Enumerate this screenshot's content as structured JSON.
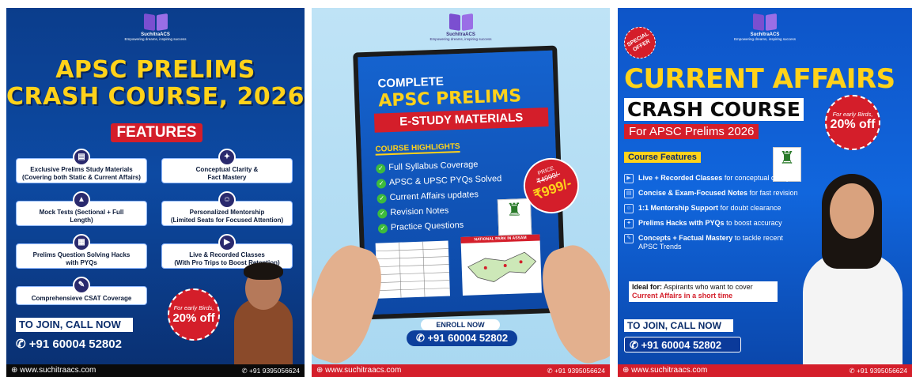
{
  "posters": {
    "p1": {
      "brand": "SuchitraACS",
      "tagline": "Empowering dreams, inspiring success",
      "title_line1": "APSC PRELIMS",
      "title_line2": "CRASH COURSE, 2026",
      "features_label": "FEATURES",
      "features": [
        {
          "icon": "book-icon",
          "l1": "Exclusive Prelims Study Materials",
          "l2": "(Covering both Static & Current Affairs)"
        },
        {
          "icon": "bulb-icon",
          "l1": "Conceptual Clarity &",
          "l2": "Fact Mastery"
        },
        {
          "icon": "graduation-cap-icon",
          "l1": "Mock Tests (Sectional + Full",
          "l2": "Length)"
        },
        {
          "icon": "mentor-icon",
          "l1": "Personalized Mentorship",
          "l2": "(Limited Seats for Focused Attention)"
        },
        {
          "icon": "notebook-icon",
          "l1": "Prelims Question Solving Hacks",
          "l2": "with PYQs"
        },
        {
          "icon": "video-class-icon",
          "l1": "Live & Recorded Classes",
          "l2": "(With Pro Trips to Boost Retention)"
        },
        {
          "icon": "csat-icon",
          "l1": "Comprehensieve CSAT Coverage",
          "l2": ""
        }
      ],
      "badge_line1": "For early Birds,",
      "badge_line2": "20% off",
      "join": "TO JOIN, CALL NOW",
      "phone": "+91 60004 52802",
      "website": "www.suchitraacs.com",
      "footer_phone": "+91 9395056624"
    },
    "p2": {
      "brand": "SuchitraACS",
      "tagline": "Empowering dreams, inspiring success",
      "complete": "COMPLETE",
      "apsc": "APSC PRELIMS",
      "estudy": "E-STUDY MATERIALS",
      "highlights_label": "COURSE HIGHLIGHTS",
      "highlights": [
        "Full Syllabus Coverage",
        "APSC & UPSC PYQs Solved",
        "Current Affairs updates",
        "Revision Notes",
        "Practice Questions"
      ],
      "price_label": "PRICE",
      "price_old": "₹4999/-",
      "price_new": "₹999/-",
      "map_title": "NATIONAL PARK IN ASSAM",
      "enroll": "ENROLL NOW",
      "phone": "+91 60004 52802",
      "website": "www.suchitraacs.com",
      "footer_phone": "+91 9395056624"
    },
    "p3": {
      "brand": "SuchitraACS",
      "tagline": "Empowering dreams, inspiring success",
      "special": "SPECIAL OFFER",
      "title": "CURRENT AFFAIRS",
      "crash": "CRASH COURSE",
      "for": "For APSC Prelims 2026",
      "badge_line1": "For early Birds,",
      "badge_line2": "20% off",
      "cf_label": "Course Features",
      "features": [
        {
          "icon": "video-icon",
          "b": "Live + Recorded Classes",
          "r": " for conceptual clarity"
        },
        {
          "icon": "notes-icon",
          "b": "Concise & Exam-Focused Notes",
          "r": " for fast revision"
        },
        {
          "icon": "mentor-icon",
          "b": "1:1 Mentorship Support",
          "r": " for doubt clearance"
        },
        {
          "icon": "hacks-icon",
          "b": "Prelims Hacks with PYQs",
          "r": " to boost accuracy"
        },
        {
          "icon": "concepts-icon",
          "b": "Concepts + Factual Mastery",
          "r": " to tackle recent APSC Trends"
        }
      ],
      "ideal_b": "Ideal for:",
      "ideal_r": " Aspirants who want to cover",
      "ideal_red": "Current Affairs in a short time",
      "join": "TO JOIN, CALL NOW",
      "phone": "+91 60004 52802",
      "website": "www.suchitraacs.com",
      "footer_phone": "+91 9395056624"
    }
  }
}
